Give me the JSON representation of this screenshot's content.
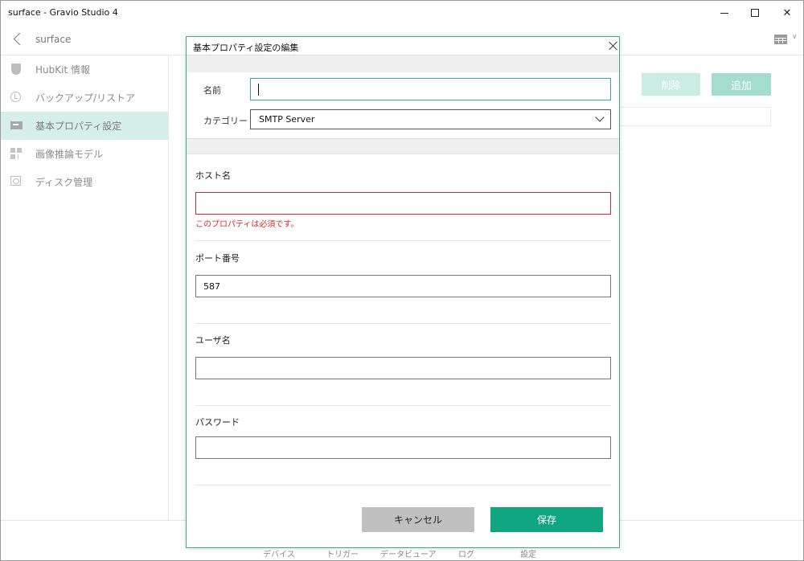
{
  "window": {
    "title": "surface - Gravio Studio 4"
  },
  "header": {
    "breadcrumb": "surface"
  },
  "sidebar": {
    "items": [
      {
        "label": "HubKit 情報",
        "icon": "shield-icon"
      },
      {
        "label": "バックアップ/リストア",
        "icon": "restore-icon"
      },
      {
        "label": "基本プロパティ設定",
        "icon": "properties-icon",
        "active": true
      },
      {
        "label": "画像推論モデル",
        "icon": "model-icon"
      },
      {
        "label": "ディスク管理",
        "icon": "disk-icon"
      }
    ]
  },
  "toolbar": {
    "delete_label": "削除",
    "add_label": "追加"
  },
  "bottom_nav": {
    "items": [
      "デバイス",
      "トリガー",
      "データビューア",
      "ログ",
      "設定"
    ]
  },
  "dialog": {
    "title": "基本プロパティ設定の編集",
    "name_label": "名前",
    "name_value": "",
    "category_label": "カテゴリー",
    "category_value": "SMTP Server",
    "host_label": "ホスト名",
    "host_value": "",
    "host_error": "このプロパティは必須です。",
    "port_label": "ポート番号",
    "port_value": "587",
    "user_label": "ユーザ名",
    "user_value": "",
    "password_label": "パスワード",
    "password_value": "",
    "cancel_label": "キャンセル",
    "save_label": "保存"
  },
  "colors": {
    "accent": "#10a680",
    "error": "#e0252b",
    "sidebar_active": "#d7efe9"
  }
}
